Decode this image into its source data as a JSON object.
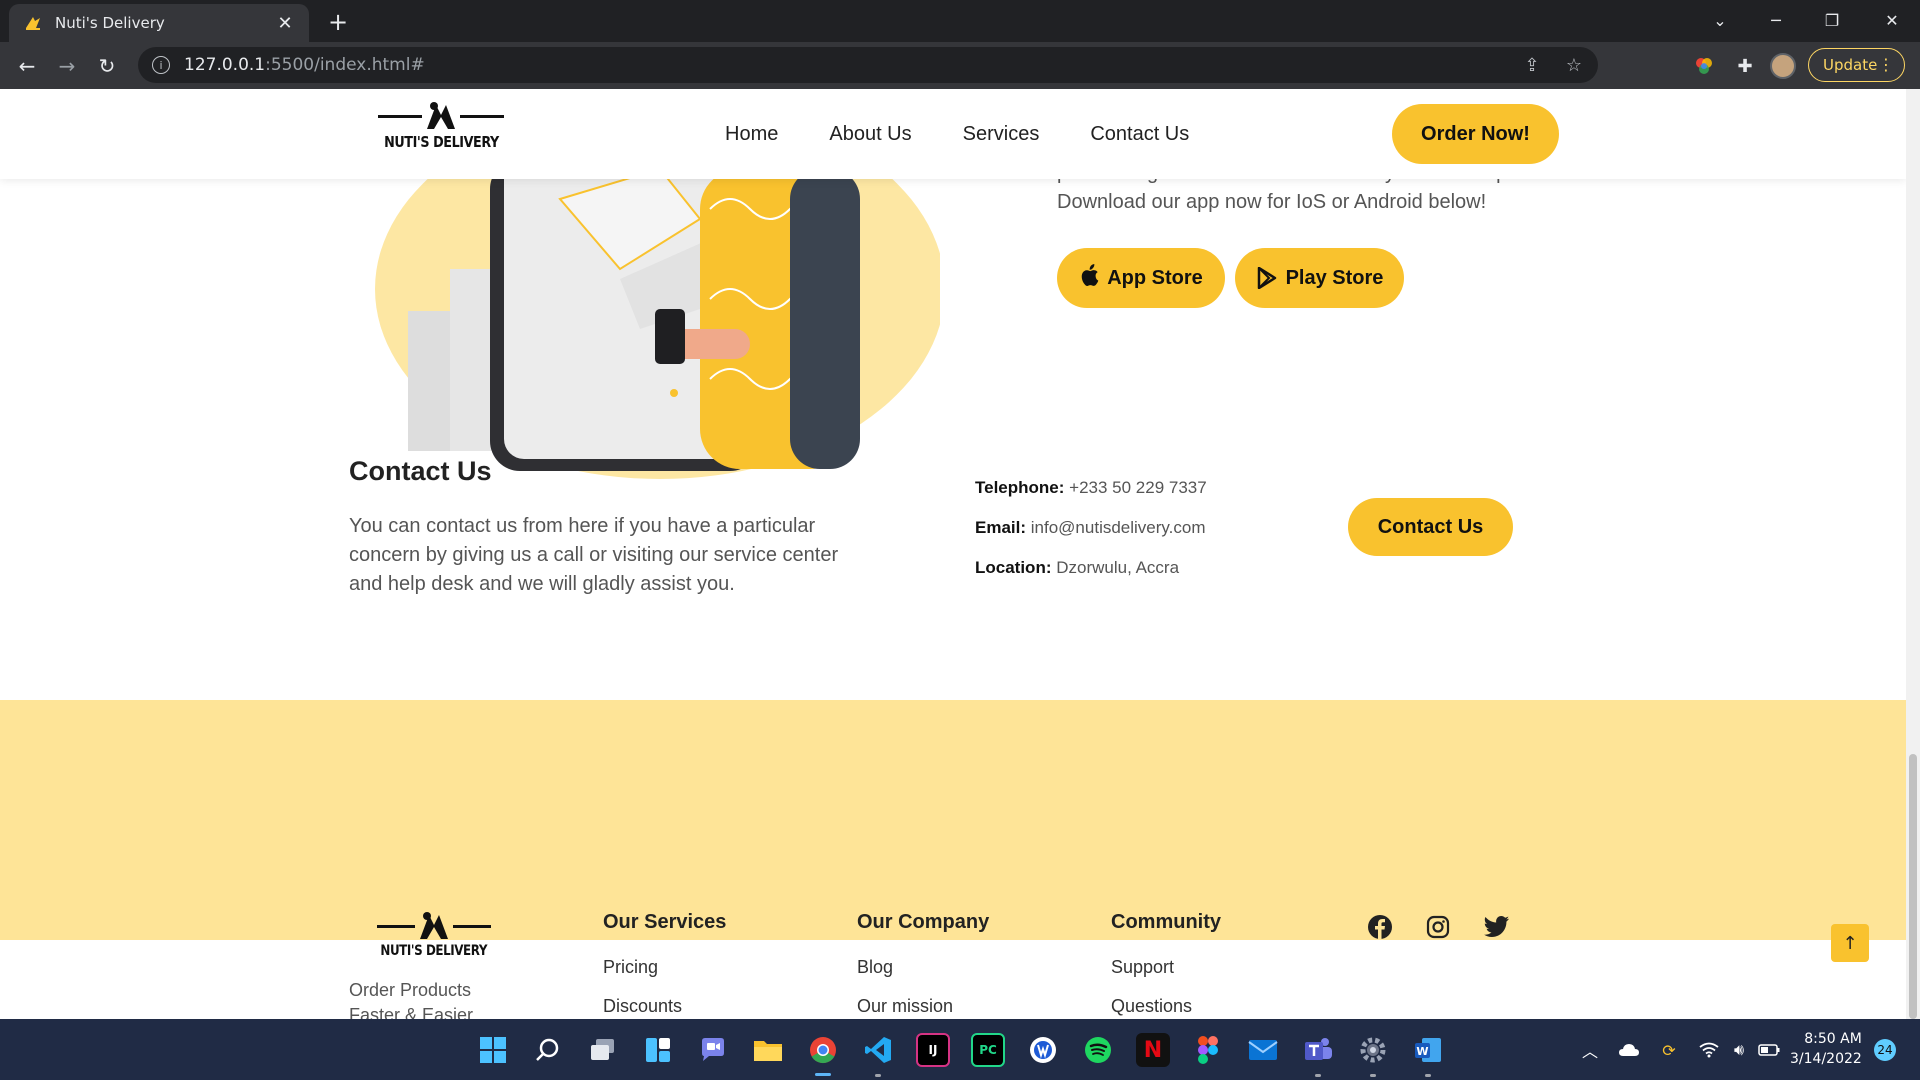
{
  "browser": {
    "tab_title": "Nuti's Delivery",
    "tab_close": "✕",
    "new_tab": "+",
    "url_host": "127.0.0.1",
    "url_path": ":5500/index.html#",
    "update_label": "Update"
  },
  "site": {
    "logo_text": "NUTI'S DELIVERY",
    "nav": [
      "Home",
      "About Us",
      "Services",
      "Contact Us"
    ],
    "order_button": "Order Now!",
    "hero_text_line1": "product organization or restaurant to your doorstep.",
    "hero_text_line2": "Download our app now for IoS or Android below!",
    "app_store": "App Store",
    "play_store": "Play Store"
  },
  "contact": {
    "title": "Contact Us",
    "description": "You can contact us from here if you have a particular concern by giving us a call or visiting our service center and help desk and we will gladly assist you.",
    "telephone_label": "Telephone:",
    "telephone_value": "+233 50 229 7337",
    "email_label": "Email:",
    "email_value": "info@nutisdelivery.com",
    "location_label": "Location:",
    "location_value": "Dzorwulu, Accra",
    "button": "Contact Us"
  },
  "footer": {
    "logo_text": "NUTI'S DELIVERY",
    "tagline_line1": "Order Products",
    "tagline_line2": "Faster & Easier",
    "columns": [
      {
        "title": "Our Services",
        "links": [
          "Pricing",
          "Discounts"
        ]
      },
      {
        "title": "Our Company",
        "links": [
          "Blog",
          "Our mission"
        ]
      },
      {
        "title": "Community",
        "links": [
          "Support",
          "Questions"
        ]
      }
    ],
    "social": [
      "facebook-icon",
      "instagram-icon",
      "twitter-icon"
    ]
  },
  "taskbar": {
    "time": "8:50 AM",
    "date": "3/14/2022",
    "notifications": "24"
  },
  "colors": {
    "accent_yellow": "#f9c22e",
    "footer_bg": "#fee497",
    "chrome_dark": "#202124",
    "taskbar_bg": "#202b45"
  }
}
